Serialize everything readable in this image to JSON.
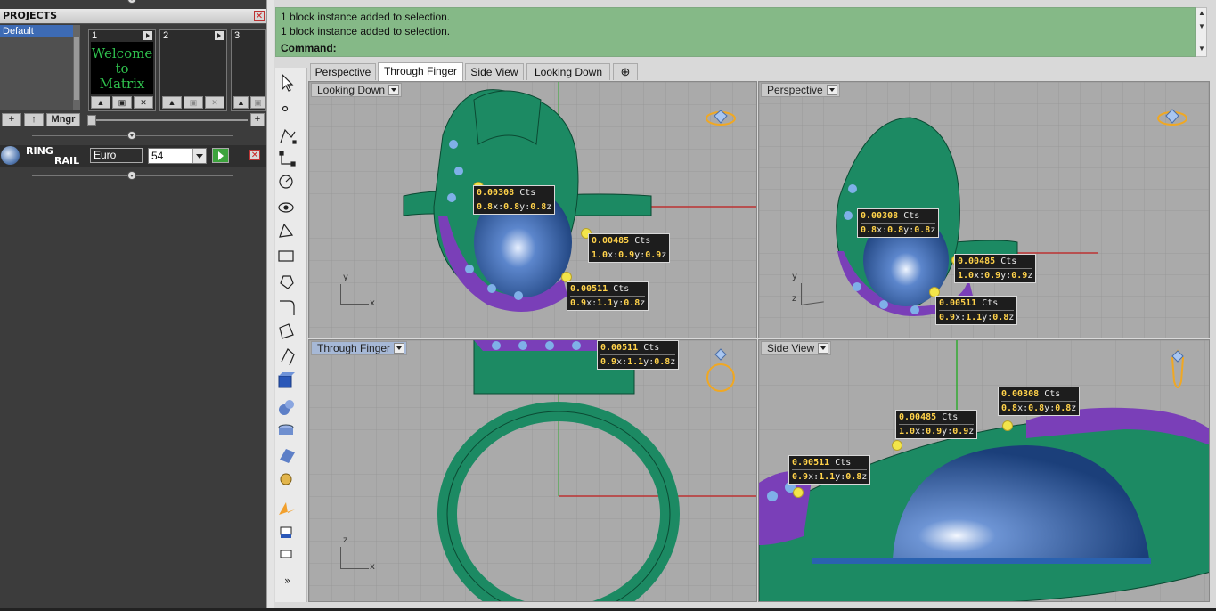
{
  "projects": {
    "title": "PROJECTS",
    "list": [
      "Default"
    ],
    "slots": [
      {
        "num": "1",
        "thumb_text": "Welcome to Matrix"
      },
      {
        "num": "2",
        "thumb_text": ""
      },
      {
        "num": "3",
        "thumb_text": ""
      }
    ],
    "toolbar": {
      "add": "+",
      "up": "↑",
      "manager": "Mngr",
      "right_add": "+"
    }
  },
  "ring_rail": {
    "label_line1": "RING",
    "label_line2": "RAIL",
    "standard": "Euro",
    "size": "54"
  },
  "command": {
    "history": [
      "1 block instance added to selection.",
      "1 block instance added to selection."
    ],
    "prompt": "Command:"
  },
  "tabs": [
    "Perspective",
    "Through Finger",
    "Side View",
    "Looking Down"
  ],
  "active_tab": "Through Finger",
  "viewports": {
    "tl": {
      "title": "Looking Down",
      "axis": [
        "y",
        "x"
      ]
    },
    "tr": {
      "title": "Perspective",
      "axis": [
        "y",
        "z"
      ]
    },
    "bl": {
      "title": "Through Finger",
      "axis": [
        "z",
        "x"
      ]
    },
    "br": {
      "title": "Side View",
      "axis": []
    }
  },
  "stones": {
    "a": {
      "ct": "0.00308",
      "unit": "Cts",
      "x": "0.8",
      "y": "0.8",
      "z": "0.8"
    },
    "b": {
      "ct": "0.00485",
      "unit": "Cts",
      "x": "1.0",
      "y": "0.9",
      "z": "0.9"
    },
    "c": {
      "ct": "0.00511",
      "unit": "Cts",
      "x": "0.9",
      "y": "1.1",
      "z": "0.8"
    }
  },
  "colors": {
    "ring": "#1c8a63",
    "gem": "#3b6fb4",
    "pave": "#7a3fb8",
    "label_value": "#ffd24a"
  }
}
